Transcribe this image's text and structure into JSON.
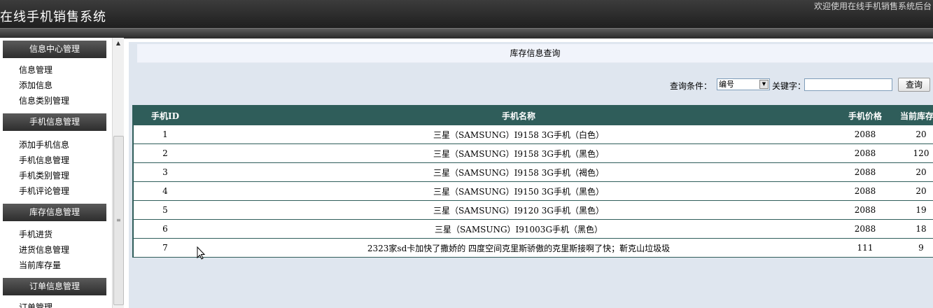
{
  "header": {
    "app_title": "在线手机销售系统",
    "welcome": "欢迎使用在线手机销售系统后台"
  },
  "sidebar": {
    "groups": [
      {
        "title": "信息中心管理",
        "items": [
          "信息管理",
          "添加信息",
          "信息类别管理"
        ]
      },
      {
        "title": "手机信息管理",
        "items": [
          "添加手机信息",
          "手机信息管理",
          "手机类别管理",
          "手机评论管理"
        ]
      },
      {
        "title": "库存信息管理",
        "items": [
          "手机进货",
          "进货信息管理",
          "当前库存量"
        ]
      },
      {
        "title": "订单信息管理",
        "items": [
          "订单管理"
        ]
      }
    ]
  },
  "content": {
    "title": "库存信息查询",
    "search": {
      "condition_label": "查询条件：",
      "condition_value": "编号",
      "keyword_label": "关键字：",
      "keyword_value": "",
      "button_label": "查询"
    },
    "table": {
      "columns": [
        "手机ID",
        "手机名称",
        "手机价格",
        "当前库存量"
      ],
      "rows": [
        [
          "1",
          "三星（SAMSUNG）I9158 3G手机（白色）",
          "2088",
          "20"
        ],
        [
          "2",
          "三星（SAMSUNG）I9158 3G手机（黑色）",
          "2088",
          "120"
        ],
        [
          "3",
          "三星（SAMSUNG）I9158 3G手机（褐色）",
          "2088",
          "20"
        ],
        [
          "4",
          "三星（SAMSUNG）I9150 3G手机（黑色）",
          "2088",
          "20"
        ],
        [
          "5",
          "三星（SAMSUNG）I9120 3G手机（黑色）",
          "2088",
          "19"
        ],
        [
          "6",
          "三星（SAMSUNG）I91003G手机（黑色）",
          "2088",
          "18"
        ],
        [
          "7",
          "2323家sd卡加快了撒娇的 四度空间克里斯骄傲的克里斯接啊了快；靳克山垃圾圾",
          "111",
          "9"
        ]
      ]
    }
  },
  "icons": {
    "select_arrow": "chevron-down-icon",
    "scroll_up": "scroll-up-icon",
    "cursor": "mouse-cursor-icon"
  }
}
